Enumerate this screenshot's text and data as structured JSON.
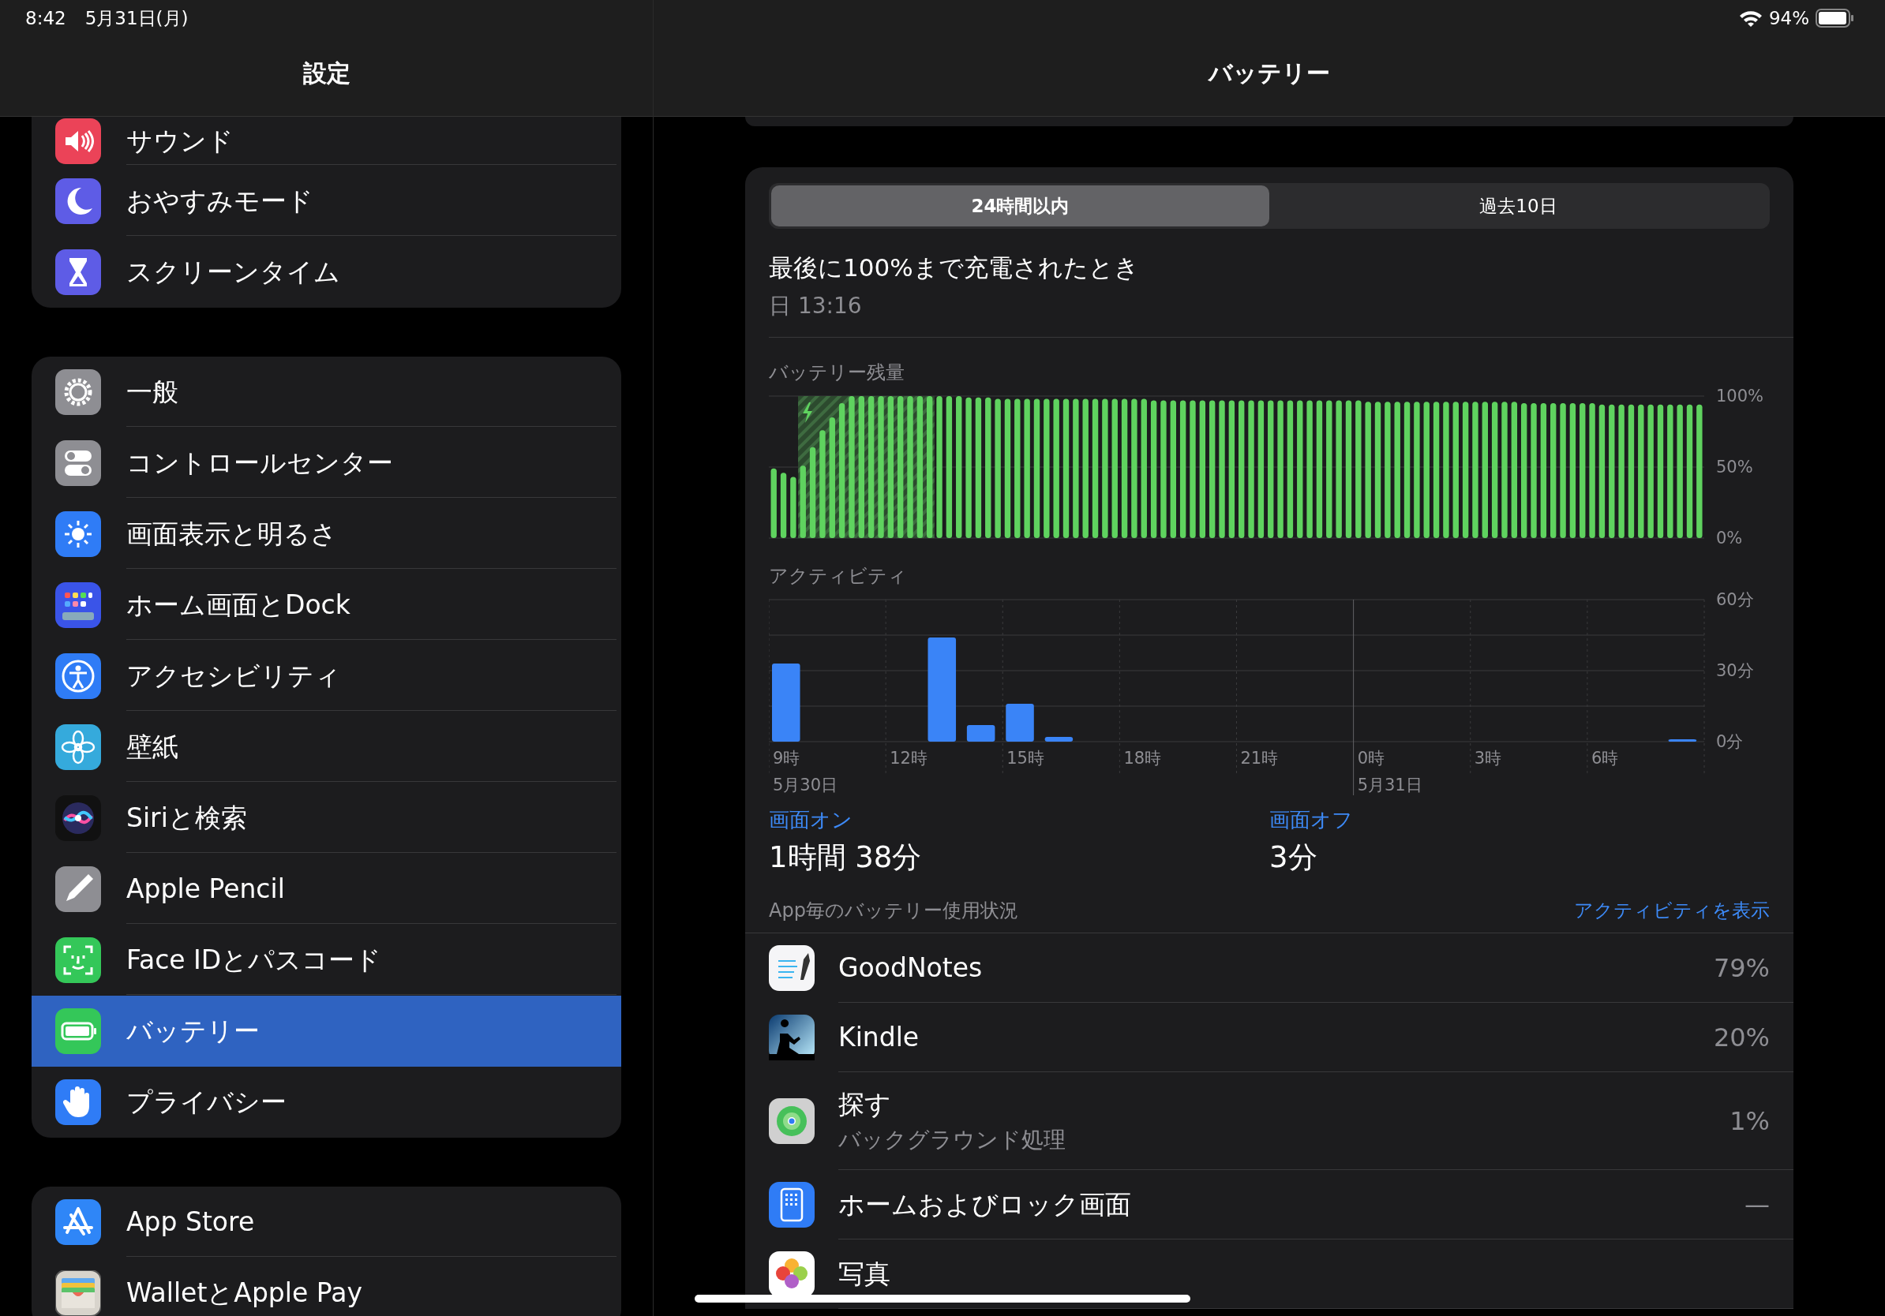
{
  "status_bar": {
    "time": "8:42",
    "date": "5月31日(月)",
    "battery": "94%"
  },
  "sidebar": {
    "title": "設定",
    "groups": [
      {
        "items": [
          {
            "label": "サウンド",
            "selected": false
          },
          {
            "label": "おやすみモード",
            "selected": false
          },
          {
            "label": "スクリーンタイム",
            "selected": false
          }
        ]
      },
      {
        "items": [
          {
            "label": "一般",
            "selected": false
          },
          {
            "label": "コントロールセンター",
            "selected": false
          },
          {
            "label": "画面表示と明るさ",
            "selected": false
          },
          {
            "label": "ホーム画面とDock",
            "selected": false
          },
          {
            "label": "アクセシビリティ",
            "selected": false
          },
          {
            "label": "壁紙",
            "selected": false
          },
          {
            "label": "Siriと検索",
            "selected": false
          },
          {
            "label": "Apple Pencil",
            "selected": false
          },
          {
            "label": "Face IDとパスコード",
            "selected": false
          },
          {
            "label": "バッテリー",
            "selected": true
          },
          {
            "label": "プライバシー",
            "selected": false
          }
        ]
      },
      {
        "items": [
          {
            "label": "App Store",
            "selected": false
          },
          {
            "label": "WalletとApple Pay",
            "selected": false
          }
        ]
      }
    ]
  },
  "detail": {
    "title": "バッテリー",
    "tabs": [
      {
        "label": "24時間以内",
        "selected": true
      },
      {
        "label": "過去10日",
        "selected": false
      }
    ],
    "last_charge": {
      "label": "最後に100%まで充電されたとき",
      "time": "日 13:16"
    },
    "battery_chart": {
      "label": "バッテリー残量",
      "chart_data": {
        "type": "bar",
        "ylim": [
          0,
          100
        ],
        "yticks": [
          {
            "value": 0,
            "label": "0%"
          },
          {
            "value": 50,
            "label": "50%"
          },
          {
            "value": 100,
            "label": "100%"
          }
        ],
        "values": [
          49,
          46,
          43,
          51,
          64,
          76,
          85,
          95,
          100,
          100,
          100,
          100,
          100,
          100,
          100,
          100,
          100,
          100,
          100,
          100,
          99,
          99,
          99,
          98,
          98,
          98,
          98,
          98,
          98,
          98,
          98,
          98,
          98,
          98,
          98,
          98,
          98,
          98,
          98,
          97,
          97,
          97,
          97,
          97,
          97,
          97,
          97,
          97,
          97,
          97,
          97,
          97,
          97,
          97,
          97,
          97,
          97,
          97,
          97,
          97,
          97,
          96,
          96,
          96,
          96,
          96,
          96,
          96,
          96,
          96,
          96,
          96,
          96,
          96,
          96,
          96,
          96,
          95,
          95,
          95,
          95,
          95,
          95,
          95,
          95,
          94,
          94,
          94,
          94,
          94,
          94,
          94,
          94,
          94,
          94,
          94
        ]
      }
    },
    "activity_chart": {
      "label": "アクティビティ",
      "dates": [
        "5月30日",
        "5月31日"
      ],
      "chart_data": {
        "type": "bar",
        "ylim": [
          0,
          60
        ],
        "yticks": [
          {
            "value": 0,
            "label": "0分"
          },
          {
            "value": 30,
            "label": "30分"
          },
          {
            "value": 60,
            "label": "60分"
          }
        ],
        "categories": [
          "9時",
          null,
          null,
          "12時",
          null,
          null,
          "15時",
          null,
          null,
          "18時",
          null,
          null,
          "21時",
          null,
          null,
          "0時",
          null,
          null,
          "3時",
          null,
          null,
          "6時",
          null,
          null
        ],
        "values": [
          33,
          0,
          0,
          0,
          44,
          7,
          16,
          2,
          0,
          0,
          0,
          0,
          0,
          0,
          0,
          0,
          0,
          0,
          0,
          0,
          0,
          0,
          0,
          1
        ]
      }
    },
    "screen_on": {
      "label": "画面オン",
      "value": "1時間 38分"
    },
    "screen_off": {
      "label": "画面オフ",
      "value": "3分"
    },
    "usage": {
      "label": "App毎のバッテリー使用状況",
      "link": "アクティビティを表示",
      "apps": [
        {
          "name": "GoodNotes",
          "percent": "79%"
        },
        {
          "name": "Kindle",
          "percent": "20%"
        },
        {
          "name": "探す",
          "subtitle": "バックグラウンド処理",
          "percent": "1%"
        },
        {
          "name": "ホームおよびロック画面",
          "percent": "—"
        },
        {
          "name": "写真"
        }
      ]
    }
  }
}
